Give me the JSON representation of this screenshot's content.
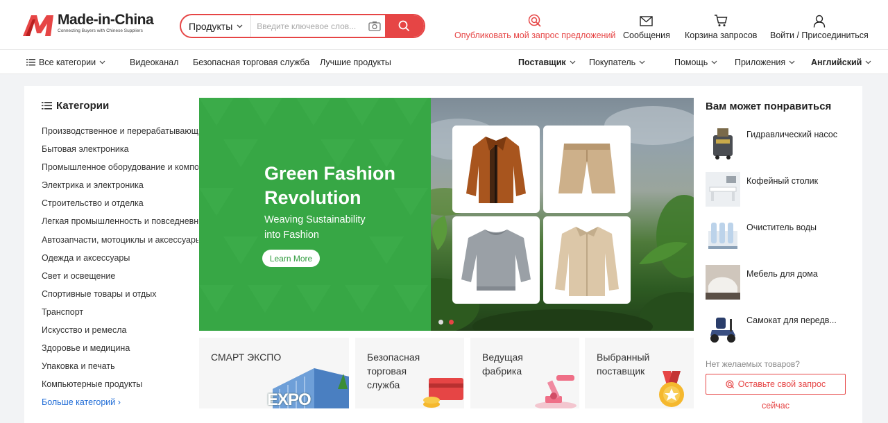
{
  "header": {
    "brand": "Made-in-China",
    "tagline": "Connecting Buyers with Chinese Suppliers",
    "search": {
      "category": "Продукты",
      "placeholder": "Введите ключевое слов..."
    },
    "post_request": "Опубликовать мой запрос предложений",
    "messages": "Сообщения",
    "cart": "Корзина запросов",
    "login": "Войти / Присоединиться"
  },
  "nav": {
    "all_categories": "Все категории",
    "video": "Видеоканал",
    "secure_trade": "Безопасная торговая служба",
    "best_products": "Лучшие продукты",
    "supplier": "Поставщик",
    "buyer": "Покупатель",
    "help": "Помощь",
    "apps": "Приложения",
    "language": "Английский"
  },
  "categories": {
    "title": "Категории",
    "items": [
      "Производственное и перерабатывающее оборудование",
      "Бытовая электроника",
      "Промышленное оборудование и компоненты",
      "Электрика и электроника",
      "Строительство и отделка",
      "Легкая промышленность и повседневное использование",
      "Автозапчасти, мотоциклы и аксессуары",
      "Одежда и аксессуары",
      "Свет и освещение",
      "Спортивные товары и отдых",
      "Транспорт",
      "Искусство и ремесла",
      "Здоровье и медицина",
      "Упаковка и печать",
      "Компьютерные продукты"
    ],
    "more": "Больше категорий"
  },
  "banner": {
    "title_line1": "Green Fashion",
    "title_line2": "Revolution",
    "sub_line1": "Weaving Sustainability",
    "sub_line2": "into Fashion",
    "button": "Learn More",
    "slide_count": 2,
    "active_slide": 2
  },
  "promos": {
    "smart_expo": "СМАРТ ЭКСПО",
    "expo_sign": "EXPO",
    "secure_l1": "Безопасная",
    "secure_l2": "торговая",
    "secure_l3": "служба",
    "factory_l1": "Ведущая",
    "factory_l2": "фабрика",
    "chosen_l1": "Выбранный",
    "chosen_l2": "поставщик"
  },
  "recommend": {
    "title": "Вам может понравиться",
    "items": [
      "Гидравлический насос",
      "Кофейный столик",
      "Очиститель воды",
      "Мебель для дома",
      "Самокат для передв..."
    ],
    "no_items": "Нет желаемых товаров?",
    "request_button": "Оставьте свой запрос",
    "now": "сейчас"
  },
  "colors": {
    "brand_red": "#e64545",
    "banner_green": "#37a745",
    "link_blue": "#1e6bd6"
  }
}
